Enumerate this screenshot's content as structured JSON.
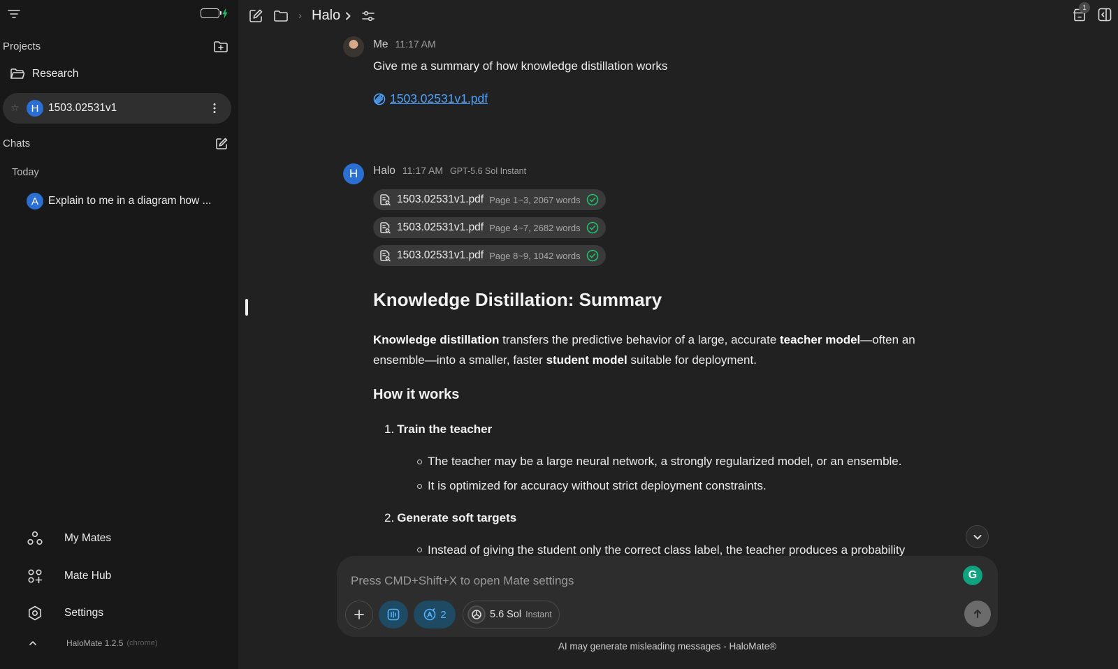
{
  "sidebar": {
    "projects_title": "Projects",
    "project_folder": "Research",
    "active_chat": {
      "avatar": "H",
      "label": "1503.02531v1"
    },
    "chats_title": "Chats",
    "today_label": "Today",
    "chat_items": [
      {
        "avatar": "A",
        "label": "Explain to me in a diagram how ..."
      }
    ],
    "nav": [
      {
        "label": "My Mates",
        "icon": "mates-icon"
      },
      {
        "label": "Mate Hub",
        "icon": "hub-icon"
      },
      {
        "label": "Settings",
        "icon": "settings-icon"
      }
    ],
    "version": "HaloMate 1.2.5",
    "version_sub": "(chrome)"
  },
  "topbar": {
    "breadcrumb_mate": "Halo",
    "notification_count": "1"
  },
  "messages": {
    "user": {
      "name": "Me",
      "time": "11:17 AM",
      "text": "Give me a summary of how knowledge distillation works",
      "attachment": "1503.02531v1.pdf"
    },
    "assistant": {
      "avatar": "H",
      "name": "Halo",
      "time": "11:17 AM",
      "model": "GPT-5.6 Sol Instant",
      "chunks": [
        {
          "file": "1503.02531v1.pdf",
          "range": "Page 1~3, 2067 words"
        },
        {
          "file": "1503.02531v1.pdf",
          "range": "Page 4~7, 2682 words"
        },
        {
          "file": "1503.02531v1.pdf",
          "range": "Page 8~9, 1042 words"
        }
      ],
      "heading": "Knowledge Distillation: Summary",
      "intro": {
        "b1": "Knowledge distillation",
        "t1": " transfers the predictive behavior of a large, accurate ",
        "b2": "teacher model",
        "t2": "—often an ensemble—into a smaller, faster ",
        "b3": "student model",
        "t3": " suitable for deployment."
      },
      "subheading": "How it works",
      "steps": [
        {
          "num": "1.",
          "title": "Train the teacher",
          "bullets": [
            "The teacher may be a large neural network, a strongly regularized model, or an ensemble.",
            "It is optimized for accuracy without strict deployment constraints."
          ]
        },
        {
          "num": "2.",
          "title": "Generate soft targets",
          "bullets": [
            "Instead of giving the student only the correct class label, the teacher produces a probability"
          ]
        }
      ]
    }
  },
  "composer": {
    "placeholder": "Press CMD+Shift+X to open Mate settings",
    "mates_count": "2",
    "model_main": "5.6 Sol",
    "model_sub": "Instant"
  },
  "footer": {
    "note": "AI may generate misleading messages - HaloMate®"
  },
  "colors": {
    "accent": "#2a6fd1",
    "link": "#4da3ff",
    "check": "#1fbf6a",
    "sidebar_bg": "#181818",
    "main_bg": "#212121"
  }
}
